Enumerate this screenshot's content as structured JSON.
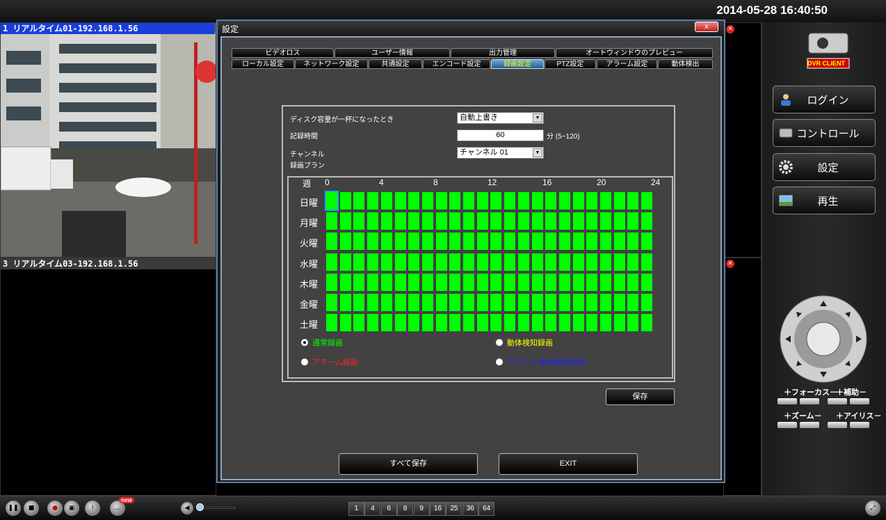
{
  "clock": "2014-05-28 16:40:50",
  "cameras": {
    "cam1_title": "1 リアルタイム01-192.168.1.56",
    "cam3_title": "3 リアルタイム03-192.168.1.56"
  },
  "dialog": {
    "title": "設定",
    "close": "x",
    "tabs_row1": [
      "ビデオロス",
      "ユーザー情報",
      "出力管理",
      "オートウィンドウのプレビュー"
    ],
    "tabs_row2": [
      "ローカル設定",
      "ネットワーク設定",
      "共通設定",
      "エンコード設定",
      "録画設定",
      "PTZ設定",
      "アラーム設定",
      "動体検出"
    ],
    "active_tab": "録画設定",
    "disk_full_label": "ディスク容量が一杯になったとき",
    "disk_full_value": "自動上書き",
    "rec_time_label": "記録時間",
    "rec_time_value": "60",
    "rec_time_unit": "分 (5~120)",
    "channel_label": "チャンネル",
    "channel_value": "チャンネル 01",
    "plan_label": "録画プラン",
    "week_label": "週",
    "hours": [
      "0",
      "4",
      "8",
      "12",
      "16",
      "20",
      "24"
    ],
    "days": [
      "日曜",
      "月曜",
      "火曜",
      "水曜",
      "木曜",
      "金曜",
      "土曜"
    ],
    "cell_color": "#00ff00",
    "radio_normal": "通常録画",
    "radio_motion": "動体検知録画",
    "radio_alarm": "アラーム録画",
    "radio_alarm_motion": "アラーム 動体検知録画",
    "save": "保存",
    "save_all": "すべて保存",
    "exit": "EXIT"
  },
  "right": {
    "logo": "DVR CLIENT",
    "login": "ログイン",
    "control": "コントロール",
    "settings": "設定",
    "playback": "再生",
    "focus": "＋フォーカス－",
    "aux": "＋補助－",
    "zoom": "＋ズーム－",
    "iris": "＋アイリス－"
  },
  "bottom": {
    "new_badge": "new",
    "layouts": [
      "1",
      "4",
      "6",
      "8",
      "9",
      "16",
      "25",
      "36",
      "64"
    ]
  }
}
